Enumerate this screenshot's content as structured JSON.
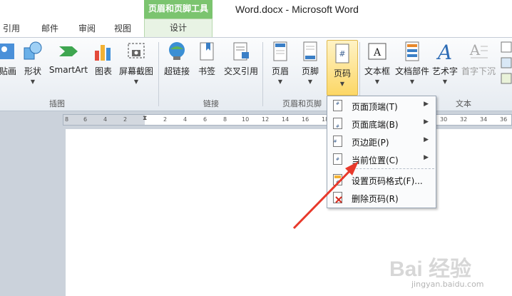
{
  "window": {
    "title": "Word.docx  -  Microsoft Word"
  },
  "context_tab_group": "页眉和页脚工具",
  "tabs": [
    "引用",
    "邮件",
    "审阅",
    "视图"
  ],
  "context_tab": "设计",
  "ribbon": {
    "buttons": [
      {
        "label": "贴画",
        "icon": "clipart-icon",
        "dropdown": false
      },
      {
        "label": "形状",
        "icon": "shapes-icon",
        "dropdown": true
      },
      {
        "label": "SmartArt",
        "icon": "smartart-icon",
        "dropdown": false
      },
      {
        "label": "图表",
        "icon": "chart-icon",
        "dropdown": false
      },
      {
        "label": "屏幕截图",
        "icon": "screenshot-icon",
        "dropdown": true
      },
      {
        "label": "超链接",
        "icon": "hyperlink-icon",
        "dropdown": false
      },
      {
        "label": "书签",
        "icon": "bookmark-icon",
        "dropdown": false
      },
      {
        "label": "交叉引用",
        "icon": "cross-reference-icon",
        "dropdown": false
      },
      {
        "label": "页眉",
        "icon": "header-icon",
        "dropdown": true
      },
      {
        "label": "页脚",
        "icon": "footer-icon",
        "dropdown": true
      },
      {
        "label": "页码",
        "icon": "page-number-icon",
        "dropdown": true,
        "active": true
      },
      {
        "label": "文本框",
        "icon": "textbox-icon",
        "dropdown": true
      },
      {
        "label": "文档部件",
        "icon": "quick-parts-icon",
        "dropdown": true
      },
      {
        "label": "艺术字",
        "icon": "wordart-icon",
        "dropdown": true
      },
      {
        "label": "首字下沉",
        "icon": "drop-cap-icon",
        "dropdown": false,
        "disabled": true
      }
    ],
    "groups": [
      "插图",
      "链接",
      "页眉和页脚",
      "文本"
    ]
  },
  "ruler": {
    "ticks": [
      "8",
      "6",
      "4",
      "2",
      "2",
      "4",
      "6",
      "8",
      "10",
      "12",
      "14",
      "16",
      "18",
      "30",
      "32",
      "34",
      "36"
    ]
  },
  "menu": {
    "items": [
      {
        "label": "页面顶端(T)",
        "icon": "page-top-icon",
        "submenu": true
      },
      {
        "label": "页面底端(B)",
        "icon": "page-bottom-icon",
        "submenu": true
      },
      {
        "label": "页边距(P)",
        "icon": "page-margin-icon",
        "submenu": true
      },
      {
        "label": "当前位置(C)",
        "icon": "current-position-icon",
        "submenu": true
      },
      {
        "label": "设置页码格式(F)...",
        "icon": "format-page-number-icon",
        "submenu": false
      },
      {
        "label": "删除页码(R)",
        "icon": "remove-page-number-icon",
        "submenu": false
      }
    ]
  },
  "annotation": {
    "color": "#e8392b"
  },
  "watermark": {
    "brand": "Bai 经验",
    "url": "jingyan.baidu.com"
  },
  "colors": {
    "context_green": "#7bc46f",
    "active_button": "#fcd766"
  }
}
